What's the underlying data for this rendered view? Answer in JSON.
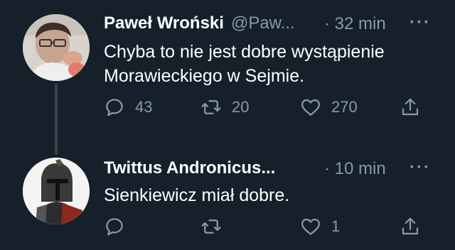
{
  "tweets": [
    {
      "name": "Paweł Wroński",
      "handle": "@Paw...",
      "time": "· 32 min",
      "more_label": "···",
      "text_line1": "Chyba to nie jest dobre wystąpienie",
      "text_line2": "Morawieckiego w Sejmie.",
      "replies": "43",
      "retweets": "20",
      "likes": "270",
      "reply_icon": "reply-icon",
      "retweet_icon": "retweet-icon",
      "like_icon": "heart-icon",
      "share_icon": "share-icon"
    },
    {
      "name": "Twittus Andronicus...",
      "time": "· 10 min",
      "more_label": "···",
      "text_line1": "Sienkiewicz miał dobre.",
      "replies": "",
      "retweets": "",
      "likes": "1",
      "reply_icon": "reply-icon",
      "retweet_icon": "retweet-icon",
      "like_icon": "heart-icon",
      "share_icon": "share-icon"
    }
  ],
  "colors": {
    "background": "#15202b",
    "primary_text": "#ffffff",
    "secondary_text": "#8b98a5",
    "thread_line": "#38444d"
  }
}
